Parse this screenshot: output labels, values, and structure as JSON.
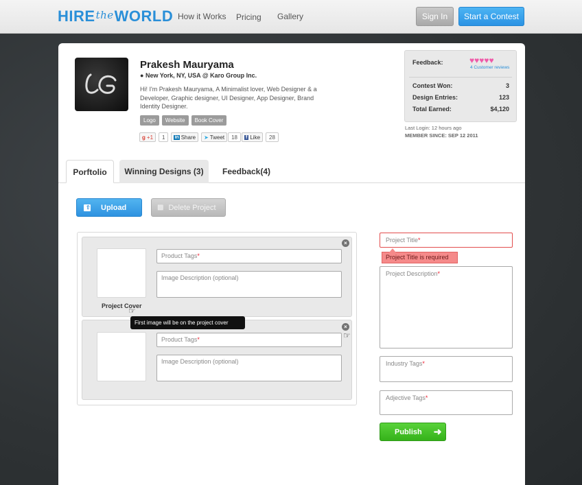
{
  "logo": {
    "hire": "HIRE",
    "the": "the",
    "world": "WORLD"
  },
  "nav": {
    "how": "How it Works",
    "pricing": "Pricing",
    "gallery": "Gallery"
  },
  "header_buttons": {
    "signin": "Sign In",
    "contest": "Start a Contest"
  },
  "profile": {
    "name": "Prakesh Mauryama",
    "location": "New York, NY, USA",
    "company": "@ Karo Group Inc.",
    "bio": "Hi! I'm Prakesh Mauryama, A Minimalist lover, Web Designer & a Developer, Graphic designer, UI Designer, App Designer, Brand Identity Designer.",
    "avatar_text": "LG",
    "tags": [
      "Logo",
      "Website",
      "Book Cover"
    ]
  },
  "social": {
    "gplus": "+1",
    "gplus_count": "1",
    "share": "Share",
    "tweet": "Tweet",
    "tweet_count": "18",
    "like": "Like",
    "like_count": "28"
  },
  "stats": {
    "feedback_label": "Feedback:",
    "hearts": "♥♥♥♥♥",
    "reviews": "4 Customer reviews",
    "contest_won_label": "Contest Won:",
    "contest_won": "3",
    "entries_label": "Design Entries:",
    "entries": "123",
    "earned_label": "Total Earned:",
    "earned": "$4,120"
  },
  "last_login": "Last Login: 12 hours ago",
  "member_since": "MEMBER SINCE: SEP 12 2011",
  "tabs": {
    "portfolio": "Porftolio",
    "winning": "Winning Designs (3)",
    "feedback": "Feedback(4)"
  },
  "actions": {
    "upload": "Upload",
    "delete": "Delete Project"
  },
  "rows": {
    "product_tags": "Product Tags",
    "image_desc": "Image Description (optional)",
    "project_cover": "Project Cover",
    "tooltip": "First image will be on the project cover",
    "close": "×"
  },
  "form": {
    "project_title": "Project Title",
    "error": "Project Title is required",
    "project_desc": "Project Description",
    "industry_tags": "Industry Tags",
    "adjective_tags": "Adjective Tags",
    "required_mark": "*",
    "publish": "Publish"
  },
  "colors": {
    "accent": "#2a8fd8",
    "publish": "#3cbf22",
    "error": "#f58a8a",
    "hearts": "#ef5aa8"
  }
}
